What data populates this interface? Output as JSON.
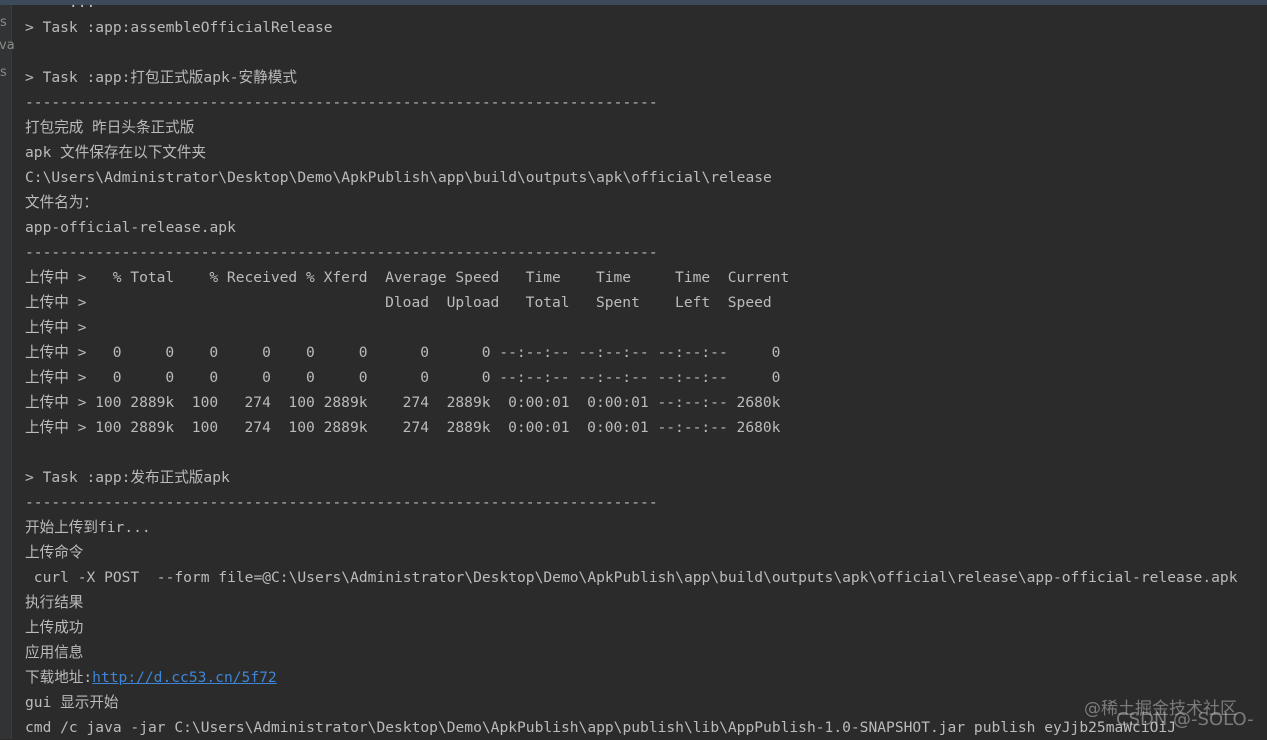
{
  "gutter_fragments": [
    "s",
    "va",
    "s"
  ],
  "console_lines": [
    "     ...",
    "> Task :app:assembleOfficialRelease",
    "",
    "> Task :app:打包正式版apk-安静模式",
    "------------------------------------------------------------------------",
    "打包完成 昨日头条正式版",
    "apk 文件保存在以下文件夹",
    "C:\\Users\\Administrator\\Desktop\\Demo\\ApkPublish\\app\\build\\outputs\\apk\\official\\release",
    "文件名为：",
    "app-official-release.apk",
    "------------------------------------------------------------------------",
    "上传中 >   % Total    % Received % Xferd  Average Speed   Time    Time     Time  Current",
    "上传中 >                                  Dload  Upload   Total   Spent    Left  Speed",
    "上传中 >",
    "上传中 >   0     0    0     0    0     0      0      0 --:--:-- --:--:-- --:--:--     0",
    "上传中 >   0     0    0     0    0     0      0      0 --:--:-- --:--:-- --:--:--     0",
    "上传中 > 100 2889k  100   274  100 2889k    274  2889k  0:00:01  0:00:01 --:--:-- 2680k",
    "上传中 > 100 2889k  100   274  100 2889k    274  2889k  0:00:01  0:00:01 --:--:-- 2680k",
    "",
    "> Task :app:发布正式版apk",
    "------------------------------------------------------------------------",
    "开始上传到fir...",
    "上传命令",
    " curl -X POST  --form file=@C:\\Users\\Administrator\\Desktop\\Demo\\ApkPublish\\app\\build\\outputs\\apk\\official\\release\\app-official-release.apk",
    "执行结果",
    "上传成功",
    "应用信息"
  ],
  "download": {
    "label": "下载地址:",
    "url": "http://d.cc53.cn/5f72"
  },
  "tail_lines": [
    "gui 显示开始",
    "cmd /c java -jar C:\\Users\\Administrator\\Desktop\\Demo\\ApkPublish\\app\\publish\\lib\\AppPublish-1.0-SNAPSHOT.jar publish eyJjb25maWciOiJ"
  ],
  "watermarks": {
    "juejin": "@稀土掘金技术社区",
    "csdn": "CSDN @-SOLO-"
  },
  "colors": {
    "background": "#2b2b2b",
    "text": "#bbbbbb",
    "link": "#3d86d8"
  }
}
